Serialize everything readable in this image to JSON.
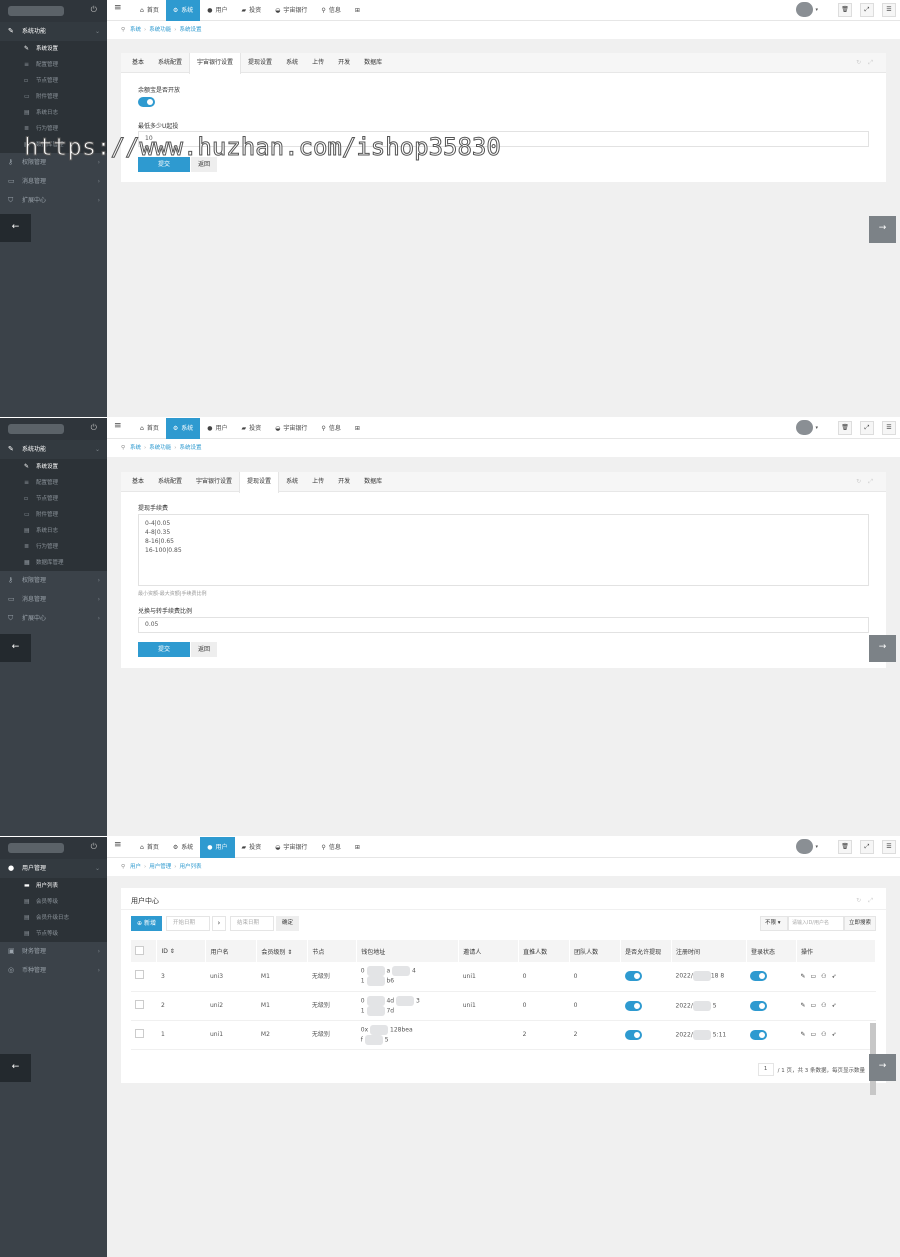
{
  "watermark": "https://www.huzhan.com/ishop35830",
  "topnav": {
    "items": [
      {
        "icon": "home-icon",
        "label": "首页"
      },
      {
        "icon": "gear-icon",
        "label": "系统"
      },
      {
        "icon": "user-icon",
        "label": "用户"
      },
      {
        "icon": "briefcase-icon",
        "label": "投资"
      },
      {
        "icon": "car-icon",
        "label": "宇宙银行"
      },
      {
        "icon": "sitemap-icon",
        "label": "信息"
      },
      {
        "icon": "grid-icon",
        "label": ""
      }
    ]
  },
  "panel1": {
    "active_nav": 1,
    "sidebar": {
      "section": "系统功能",
      "subitems": [
        "系统设置",
        "配置管理",
        "节点管理",
        "附件管理",
        "系统日志",
        "行为管理",
        "数据库管理"
      ],
      "groups": [
        "权限管理",
        "消息管理",
        "扩展中心"
      ]
    },
    "breadcrumb": [
      "系统",
      "系统功能",
      "系统设置"
    ],
    "tabs": [
      "基本",
      "系统配置",
      "宇宙银行设置",
      "提现设置",
      "系统",
      "上传",
      "开发",
      "数据库"
    ],
    "active_tab": 2,
    "form": {
      "toggle_label": "余额宝是否开放",
      "toggle_on": true,
      "min_label": "最低多少U起投",
      "min_value": "10"
    },
    "submit": "提交",
    "back": "返回"
  },
  "panel2": {
    "active_nav": 1,
    "breadcrumb": [
      "系统",
      "系统功能",
      "系统设置"
    ],
    "tabs": [
      "基本",
      "系统配置",
      "宇宙银行设置",
      "提现设置",
      "系统",
      "上传",
      "开发",
      "数据库"
    ],
    "active_tab": 3,
    "form": {
      "fee_label": "提现手续费",
      "fee_value": "0-4|0.05\n4-8|0.35\n8-16|0.65\n16-100|0.85",
      "fee_hint": "最小资额-最大资额|手续费比例",
      "ratio_label": "兑换与转手续费比例",
      "ratio_value": "0.05"
    },
    "submit": "提交",
    "back": "返回"
  },
  "panel3": {
    "active_nav": 2,
    "sidebar": {
      "section": "用户管理",
      "subitems": [
        "用户列表",
        "会员等级",
        "会员升级日志",
        "节点等级"
      ],
      "groups": [
        "财务管理",
        "币种管理"
      ]
    },
    "breadcrumb": [
      "用户",
      "用户管理",
      "用户列表"
    ],
    "title": "用户中心",
    "toolbar": {
      "add": "新增",
      "start_date": "开始日期",
      "end_date": "结束日期",
      "confirm": "确定",
      "filter": "不限",
      "search_placeholder": "请输入ID/用户名",
      "search": "立即搜索"
    },
    "columns": [
      "ID ⇕",
      "用户名",
      "会员级别 ⇕",
      "节点",
      "钱包地址",
      "邀请人",
      "直推人数",
      "团队人数",
      "是否允许提现",
      "注册时间",
      "登录状态",
      "操作"
    ],
    "rows": [
      {
        "id": "3",
        "username": "uni3",
        "level": "M1",
        "node": "无级别",
        "wallet_a": "0",
        "wallet_b": "a",
        "wallet_c": "4",
        "wallet_d": "1",
        "wallet_e": "b6",
        "inviter": "uni1",
        "direct": "0",
        "team": "0",
        "withdraw": true,
        "reg_a": "2022/",
        "reg_b": "18",
        "reg_c": "8",
        "login": true
      },
      {
        "id": "2",
        "username": "uni2",
        "level": "M1",
        "node": "无级别",
        "wallet_a": "0",
        "wallet_b": "4d",
        "wallet_c": "3",
        "wallet_d": "1",
        "wallet_e": "7d",
        "inviter": "uni1",
        "direct": "0",
        "team": "0",
        "withdraw": true,
        "reg_a": "2022/",
        "reg_b": "",
        "reg_c": "5",
        "login": true
      },
      {
        "id": "1",
        "username": "uni1",
        "level": "M2",
        "node": "无级别",
        "wallet_a": "0x",
        "wallet_b": "128bea",
        "wallet_c": "",
        "wallet_d": "f",
        "wallet_e": "5",
        "inviter": "",
        "direct": "2",
        "team": "2",
        "withdraw": true,
        "reg_a": "2022/",
        "reg_b": "",
        "reg_c": "5:11",
        "login": true
      }
    ],
    "pager": {
      "page": "1",
      "summary": "/ 1 页，共 3 条数据，每页显示数量",
      "per_page": "20"
    }
  }
}
